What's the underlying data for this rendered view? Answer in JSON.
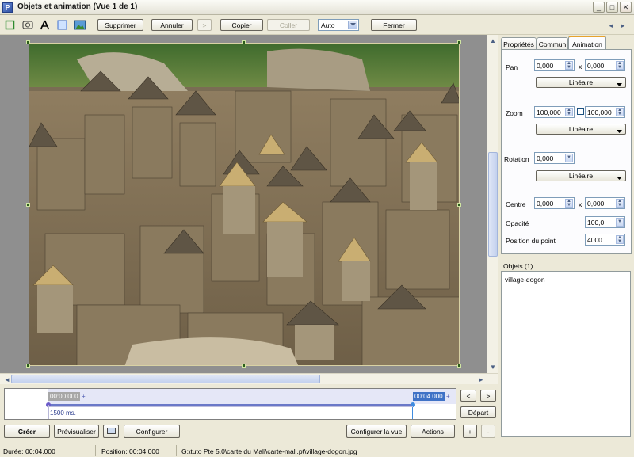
{
  "window": {
    "title": "Objets et animation  (Vue 1 de 1)",
    "app_icon": "app-icon",
    "minimize": "_",
    "maximize": "□",
    "close": "✕"
  },
  "toolbar": {
    "icons": [
      "rectangle-select-icon",
      "ellipse-icon",
      "text-icon",
      "frame-icon",
      "image-icon"
    ],
    "buttons": {
      "supprimer": "Supprimer",
      "annuler": "Annuler",
      "forward": ">",
      "copier": "Copier",
      "coller": "Coller",
      "fermer": "Fermer"
    },
    "zoom_select": "Auto",
    "nav_prev": "◄",
    "nav_next": "►"
  },
  "tabs": [
    "Propriétés",
    "Commun",
    "Animation"
  ],
  "animation": {
    "pan": {
      "label": "Pan",
      "x": "0,000",
      "sep": "x",
      "y": "0,000",
      "mode": "Linéaire"
    },
    "zoom": {
      "label": "Zoom",
      "x": "100,000",
      "y": "100,000",
      "mode": "Linéaire"
    },
    "rotation": {
      "label": "Rotation",
      "value": "0,000",
      "mode": "Linéaire"
    },
    "centre": {
      "label": "Centre",
      "x": "0,000",
      "sep": "x",
      "y": "0,000"
    },
    "opacite": {
      "label": "Opacité",
      "value": "100,0"
    },
    "position_point": {
      "label": "Position du point",
      "value": "4000"
    }
  },
  "objects": {
    "header": "Objets (1)",
    "items": [
      "village-dogon"
    ]
  },
  "timeline": {
    "start_time": "00:00.000",
    "end_time": "00:04.000",
    "segment": "1500 ms.",
    "prev": "<",
    "next": ">",
    "depart": "Départ"
  },
  "bottom": {
    "creer": "Créer",
    "previsualiser": "Prévisualiser",
    "configurer": "Configurer",
    "configurer_vue": "Configurer la vue",
    "actions": "Actions",
    "plus": "+",
    "minus": "-"
  },
  "status": {
    "duree_label": "Durée:",
    "duree": "00:04.000",
    "position_label": "Position:",
    "position": "00:04.000",
    "path": "G:\\tuto Pte 5.0\\carte du Mali\\carte-mali.pt\\village-dogon.jpg"
  }
}
